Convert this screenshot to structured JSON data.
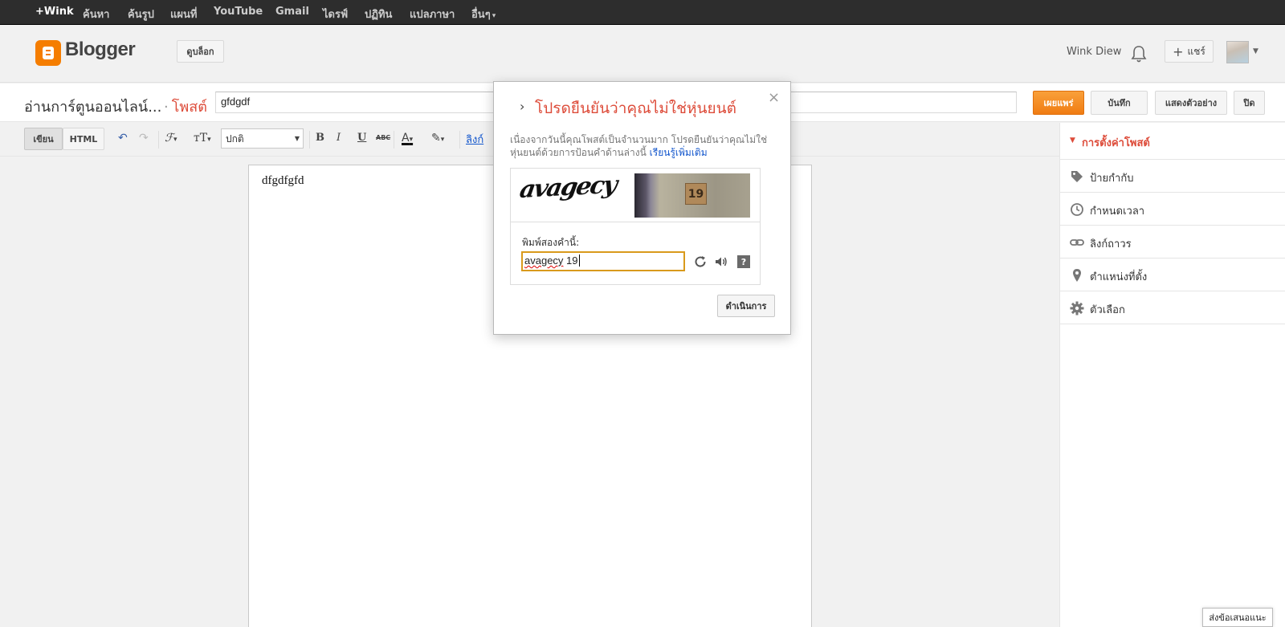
{
  "google_bar": {
    "items": [
      "+Wink",
      "ค้นหา",
      "ค้นรูป",
      "แผนที่",
      "YouTube",
      "Gmail",
      "ไดรฟ์",
      "ปฏิทิน",
      "แปลภาษา",
      "อื่นๆ"
    ]
  },
  "header": {
    "brand": "Blogger",
    "view_blog_label": "ดูบล็อก",
    "user_name": "Wink Diew",
    "share_label": "แชร์",
    "share_plus": "+"
  },
  "post_bar": {
    "blog_name": "อ่านการ์ตูนออนไลน์...",
    "post_label": "โพสต์",
    "title_value": "gfdgdf",
    "publish_label": "เผยแพร่",
    "save_label": "บันทึก",
    "preview_label": "แสดงตัวอย่าง",
    "close_label": "ปิด"
  },
  "toolbar": {
    "compose_label": "เขียน",
    "html_label": "HTML",
    "font_value": "ปกติ",
    "link_label": "ลิงก์",
    "bold": "B",
    "italic": "I",
    "underline": "U",
    "strike": "ABC"
  },
  "editor": {
    "body_text": "dfgdfgfd"
  },
  "side_panel": {
    "heading": "การตั้งค่าโพสต์",
    "items": [
      {
        "label": "ป้ายกำกับ",
        "icon": "tag-icon"
      },
      {
        "label": "กำหนดเวลา",
        "icon": "clock-icon"
      },
      {
        "label": "ลิงก์ถาวร",
        "icon": "link-icon"
      },
      {
        "label": "ตำแหน่งที่ตั้ง",
        "icon": "location-pin-icon"
      },
      {
        "label": "ตัวเลือก",
        "icon": "gear-icon"
      }
    ]
  },
  "captcha_dialog": {
    "title": "โปรดยืนยันว่าคุณไม่ใช่หุ่นยนต์",
    "description": "เนื่องจากวันนี้คุณโพสต์เป็นจำนวนมาก โปรดยืนยันว่าคุณไม่ใช่หุ่นยนต์ด้วยการป้อนคำด้านล่างนี้",
    "learn_more": "เรียนรู้เพิ่มเติม",
    "captcha_word": "avagecy",
    "captcha_number": "19",
    "input_label": "พิมพ์สองคำนี้:",
    "input_value_word": "avagecy",
    "input_value_number": " 19",
    "help_glyph": "?",
    "continue_label": "ดำเนินการ",
    "close_glyph": "×",
    "arrow_glyph": "›"
  },
  "feedback_label": "ส่งข้อเสนอแนะ",
  "colors": {
    "accent": "#dd4b39",
    "publish": "#f07c13",
    "google_bar": "#2d2d2d",
    "blogger_orange": "#f57d00"
  }
}
